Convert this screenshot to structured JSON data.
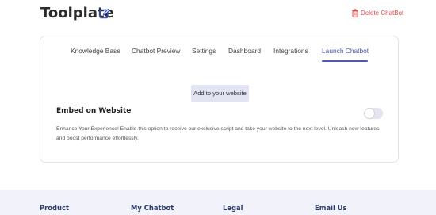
{
  "header": {
    "title": "Toolplate",
    "edit_icon": "edit-icon",
    "delete_label": "Delete ChatBot",
    "delete_icon": "trash-icon",
    "delete_color": "#e04848"
  },
  "tabs": [
    {
      "label": "Knowledge Base",
      "active": false
    },
    {
      "label": "Chatbot Preview",
      "active": false
    },
    {
      "label": "Settings",
      "active": false
    },
    {
      "label": "Dashboard",
      "active": false
    },
    {
      "label": "Integrations",
      "active": false
    },
    {
      "label": "Launch Chatbot",
      "active": true
    }
  ],
  "accent_color": "#4a5bb5",
  "add_button_label": "Add to your website",
  "embed": {
    "heading": "Embed on Website",
    "description": "Enhance Your Experience! Enable this option to receive our exclusive script and take your website to the next level. Unleash new features and boost performance effortlessly.",
    "toggle_on": false
  },
  "footer": {
    "headings": [
      "Product",
      "My Chatbot",
      "Legal",
      "Email Us"
    ]
  }
}
